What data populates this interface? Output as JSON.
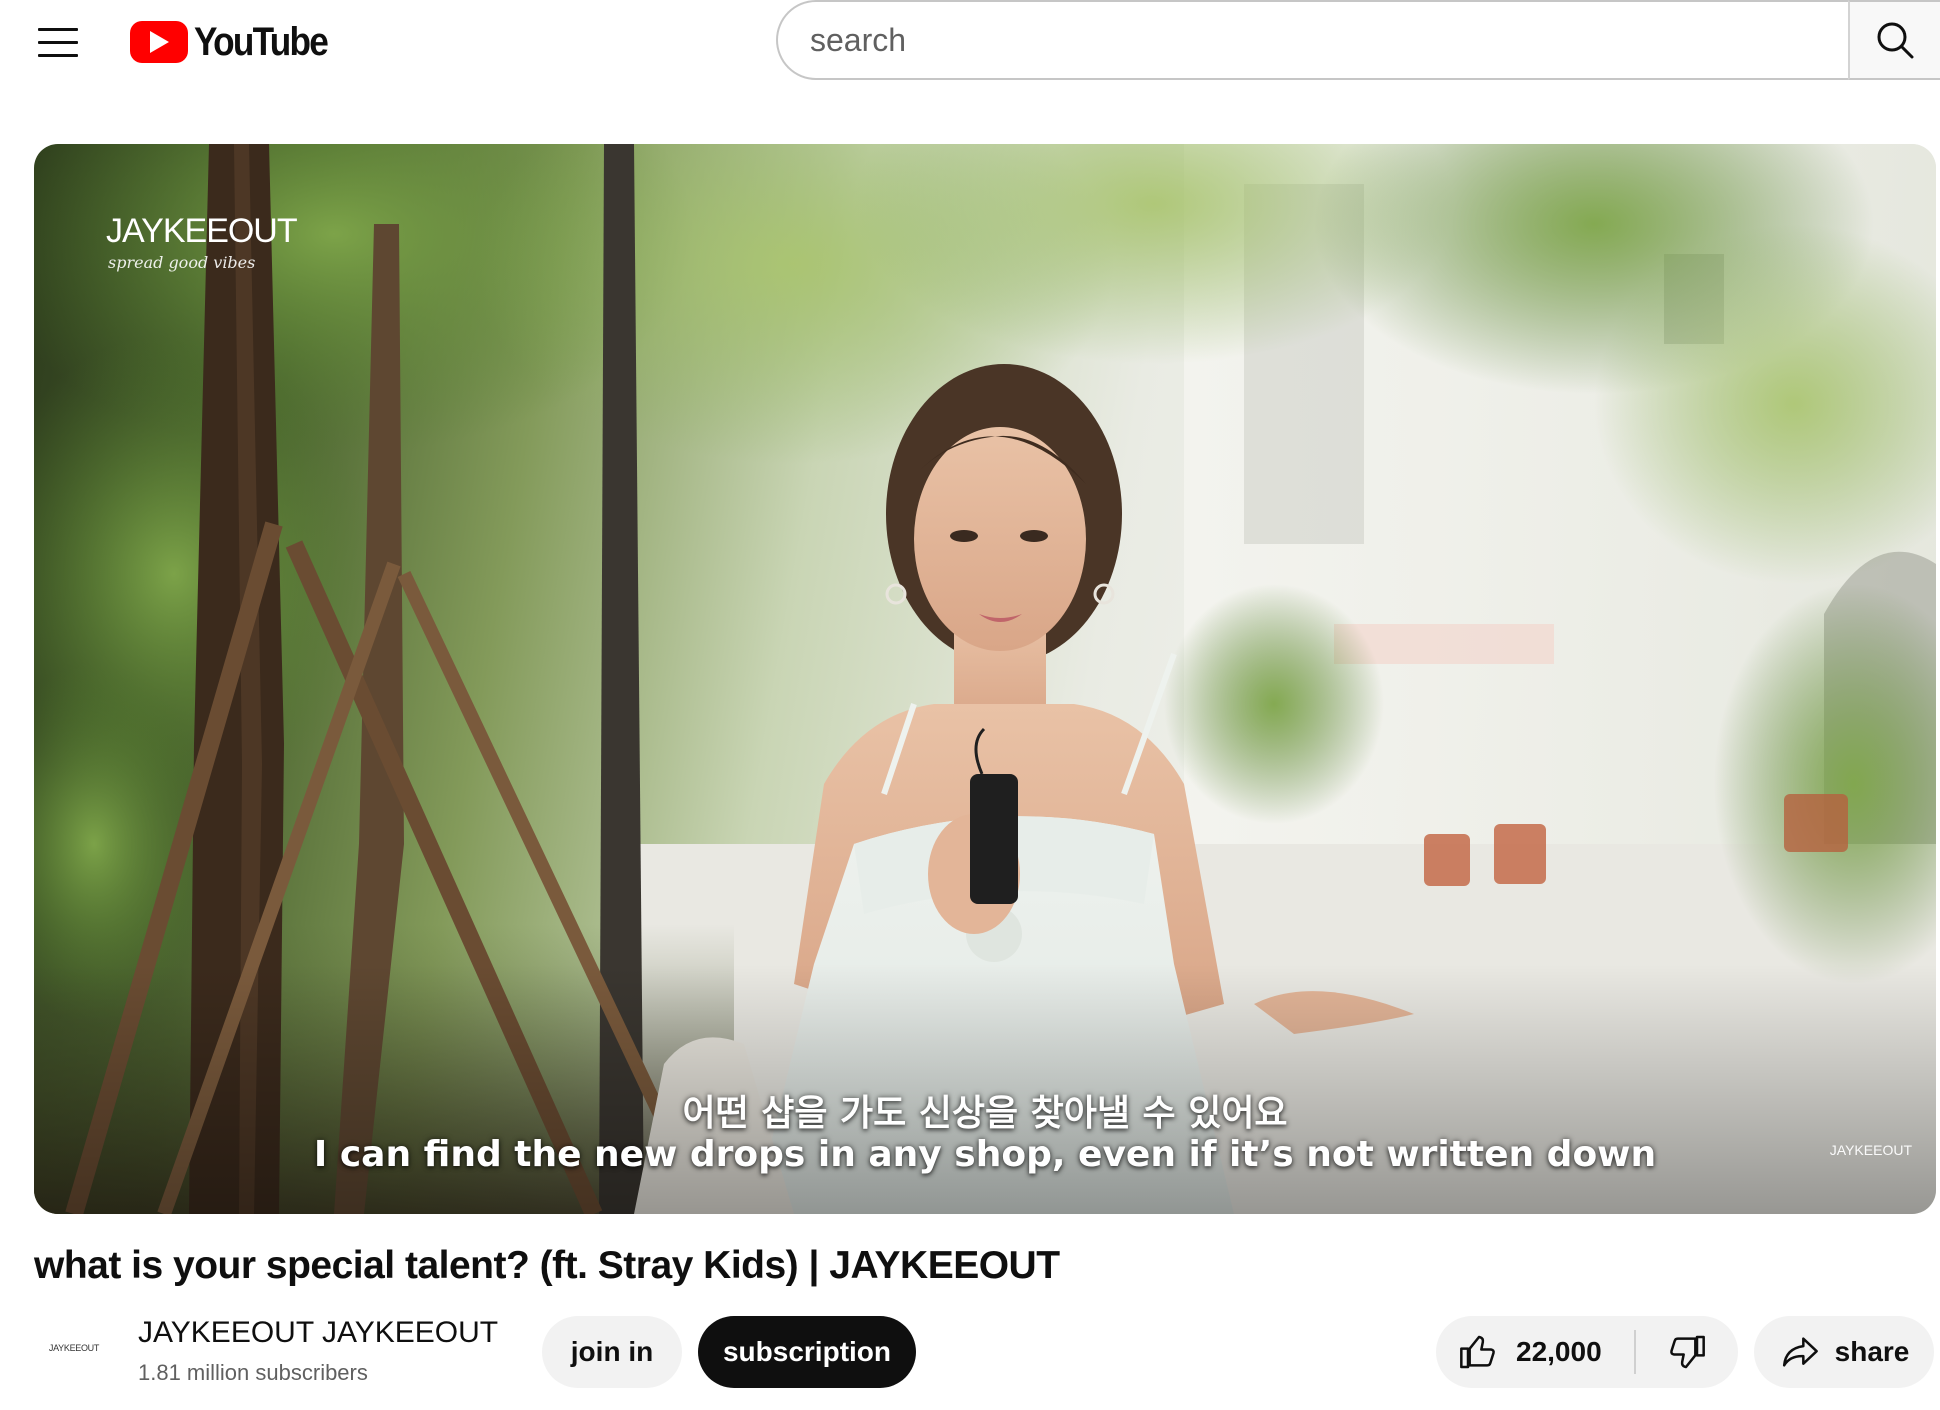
{
  "header": {
    "logo_text": "YouTube",
    "search_placeholder": "search"
  },
  "video": {
    "watermark_name": "JAYKEEOUT",
    "watermark_tagline": "spread good vibes",
    "watermark_corner": "JAYKEEOUT",
    "subtitle_korean": "어떤 샵을 가도 신상을 찾아낼 수 있어요",
    "subtitle_english": "I can find the new drops in any shop, even if it’s not written down",
    "title": "what is your special talent? (ft. Stray Kids) | JAYKEEOUT"
  },
  "channel": {
    "avatar_text": "JAYKEEOUT",
    "name": "JAYKEEOUT JAYKEEOUT",
    "subscribers": "1.81 million subscribers",
    "join_label": "join in",
    "subscribe_label": "subscription"
  },
  "actions": {
    "like_count": "22,000",
    "share_label": "share"
  },
  "colors": {
    "brand_red": "#ff0000",
    "subscribe_bg": "#0f0f0f",
    "pill_bg": "#f2f2f2"
  }
}
